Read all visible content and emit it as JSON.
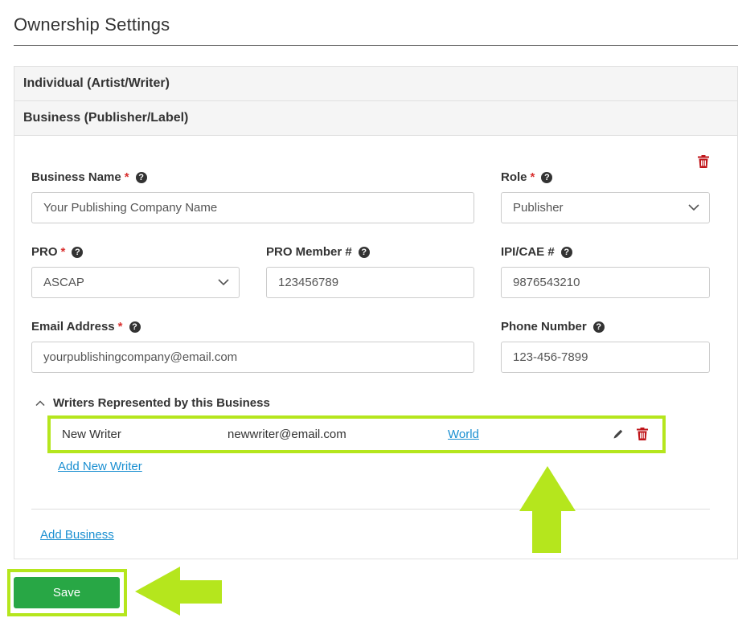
{
  "page": {
    "title": "Ownership Settings"
  },
  "panels": {
    "individual": "Individual (Artist/Writer)",
    "business": "Business (Publisher/Label)"
  },
  "form": {
    "business_name": {
      "label": "Business Name",
      "value": "Your Publishing Company Name"
    },
    "role": {
      "label": "Role",
      "value": "Publisher"
    },
    "pro": {
      "label": "PRO",
      "value": "ASCAP"
    },
    "pro_member": {
      "label": "PRO Member #",
      "value": "123456789"
    },
    "ipi": {
      "label": "IPI/CAE #",
      "value": "9876543210"
    },
    "email": {
      "label": "Email Address",
      "value": "yourpublishingcompany@email.com"
    },
    "phone": {
      "label": "Phone Number",
      "value": "123-456-7899"
    },
    "required_mark": "*"
  },
  "writers": {
    "heading": "Writers Represented by this Business",
    "rows": [
      {
        "name": "New Writer",
        "email": "newwriter@email.com",
        "territory": "World"
      }
    ],
    "add_label": "Add New Writer"
  },
  "add_business_label": "Add Business",
  "save_label": "Save",
  "colors": {
    "highlight": "#b5e61d",
    "save": "#28a745",
    "link": "#1a8fd1",
    "danger": "#c0161b"
  },
  "icons": [
    "help-icon",
    "trash-icon",
    "chevron-down-icon",
    "chevron-up-icon",
    "pencil-icon",
    "arrow-up-annotation",
    "arrow-left-annotation"
  ]
}
